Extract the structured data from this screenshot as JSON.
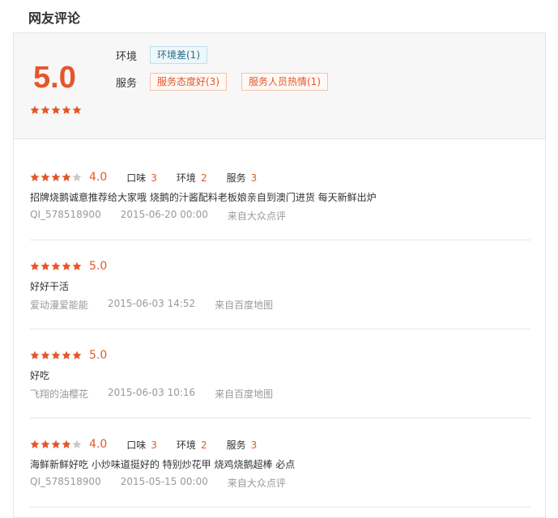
{
  "section_title": "网友评论",
  "summary": {
    "score": "5.0",
    "rows": [
      {
        "label": "环境",
        "tags": [
          {
            "text": "环境差(1)",
            "kind": "neg"
          }
        ]
      },
      {
        "label": "服务",
        "tags": [
          {
            "text": "服务态度好(3)",
            "kind": "pos"
          },
          {
            "text": "服务人员热情(1)",
            "kind": "pos"
          }
        ]
      }
    ],
    "stars": 5
  },
  "reviews": [
    {
      "stars": 4,
      "rating": "4.0",
      "has_sub": true,
      "sub": [
        {
          "label": "口味",
          "value": "3"
        },
        {
          "label": "环境",
          "value": "2"
        },
        {
          "label": "服务",
          "value": "3"
        }
      ],
      "content": "招牌烧鹅诚意推荐给大家哦 烧鹅的汁酱配料老板娘亲自到澳门进货 每天新鲜出炉",
      "user": "QI_578518900",
      "date": "2015-06-20 00:00",
      "source": "来自大众点评"
    },
    {
      "stars": 5,
      "rating": "5.0",
      "has_sub": false,
      "sub": [],
      "content": "好好干活",
      "user": "爱动漫爱能能",
      "date": "2015-06-03 14:52",
      "source": "来自百度地图"
    },
    {
      "stars": 5,
      "rating": "5.0",
      "has_sub": false,
      "sub": [],
      "content": "好吃",
      "user": "飞翔的油樱花",
      "date": "2015-06-03 10:16",
      "source": "来自百度地图"
    },
    {
      "stars": 4,
      "rating": "4.0",
      "has_sub": true,
      "sub": [
        {
          "label": "口味",
          "value": "3"
        },
        {
          "label": "环境",
          "value": "2"
        },
        {
          "label": "服务",
          "value": "3"
        }
      ],
      "content": "海鲜新鲜好吃 小炒味道挺好的 特别炒花甲 烧鸡烧鹅超棒 必点",
      "user": "QI_578518900",
      "date": "2015-05-15 00:00",
      "source": "来自大众点评"
    }
  ],
  "colors": {
    "accent": "#e4572a",
    "star_on": "#e4572a",
    "star_off": "#c8c8c8"
  }
}
